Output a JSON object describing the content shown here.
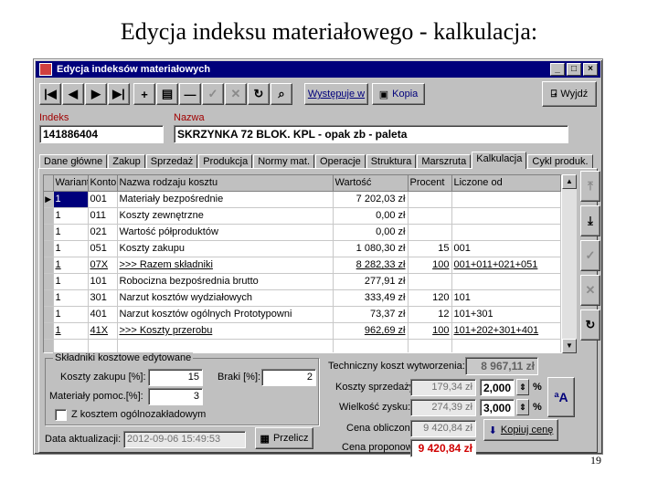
{
  "slide": {
    "title": "Edycja indeksu materiałowego - kalkulacja:",
    "page_number": "19"
  },
  "window": {
    "title": "Edycja indeksów materiałowych",
    "controls": [
      "_",
      "□",
      "×"
    ]
  },
  "toolbar": {
    "buttons": [
      "first-icon",
      "previous-icon",
      "next-icon",
      "last-icon",
      "add-icon",
      "copy-record-icon",
      "delete-icon",
      "confirm-icon",
      "cancel-icon",
      "refresh-icon",
      "find-icon"
    ],
    "wystepuje_label": "Występuje w",
    "kopia_label": "Kopia",
    "wyjdz_label": "Wyjdź"
  },
  "header": {
    "indeks_label": "Indeks",
    "indeks_value": "141886404",
    "nazwa_label": "Nazwa",
    "nazwa_value": "SKRZYNKA 72 BLOK. KPL - opak zb - paleta"
  },
  "tabs": [
    "Dane główne",
    "Zakup",
    "Sprzedaż",
    "Produkcja",
    "Normy mat.",
    "Operacje",
    "Struktura",
    "Marszruta",
    "Kalkulacja",
    "Cykl produk."
  ],
  "active_tab": "Kalkulacja",
  "grid": {
    "columns": [
      "Wariant",
      "Konto",
      "Nazwa rodzaju kosztu",
      "Wartość",
      "Procent",
      "Liczone od"
    ],
    "rows": [
      {
        "marker": "▶",
        "wariant": "1",
        "konto": "001",
        "nazwa": "Materiały bezpośrednie",
        "wartosc": "7 202,03 zł",
        "procent": "",
        "liczone_od": ""
      },
      {
        "marker": "",
        "wariant": "1",
        "konto": "011",
        "nazwa": "Koszty zewnętrzne",
        "wartosc": "0,00 zł",
        "procent": "",
        "liczone_od": ""
      },
      {
        "marker": "",
        "wariant": "1",
        "konto": "021",
        "nazwa": "Wartość półproduktów",
        "wartosc": "0,00 zł",
        "procent": "",
        "liczone_od": ""
      },
      {
        "marker": "",
        "wariant": "1",
        "konto": "051",
        "nazwa": "Koszty zakupu",
        "wartosc": "1 080,30 zł",
        "procent": "15",
        "liczone_od": "001"
      },
      {
        "marker": "",
        "wariant": "1",
        "konto": "07X",
        "nazwa": ">>> Razem składniki",
        "wartosc": "8 282,33 zł",
        "procent": "100",
        "liczone_od": "001+011+021+051"
      },
      {
        "marker": "",
        "wariant": "1",
        "konto": "101",
        "nazwa": "Robocizna bezpośrednia brutto",
        "wartosc": "277,91 zł",
        "procent": "",
        "liczone_od": ""
      },
      {
        "marker": "",
        "wariant": "1",
        "konto": "301",
        "nazwa": "Narzut kosztów wydziałowych",
        "wartosc": "333,49 zł",
        "procent": "120",
        "liczone_od": "101"
      },
      {
        "marker": "",
        "wariant": "1",
        "konto": "401",
        "nazwa": "Narzut kosztów ogólnych Prototypowni",
        "wartosc": "73,37 zł",
        "procent": "12",
        "liczone_od": "101+301"
      },
      {
        "marker": "",
        "wariant": "1",
        "konto": "41X",
        "nazwa": ">>> Koszty przerobu",
        "wartosc": "962,69 zł",
        "procent": "100",
        "liczone_od": "101+202+301+401"
      },
      {
        "marker": "",
        "wariant": "",
        "konto": "",
        "nazwa": "",
        "wartosc": "",
        "procent": "",
        "liczone_od": ""
      }
    ]
  },
  "editable_components": {
    "group_title": "Składniki kosztowe edytowane",
    "koszty_zakupu_label": "Koszty zakupu [%]:",
    "koszty_zakupu_value": "15",
    "braki_label": "Braki [%]:",
    "braki_value": "2",
    "materialy_pomoc_label": "Materiały pomoc.[%]:",
    "materialy_pomoc_value": "3",
    "overhead_checkbox_label": "Z kosztem ogólnozakładowym",
    "overhead_checked": false
  },
  "footer": {
    "data_aktualizacji_label": "Data aktualizacji:",
    "data_aktualizacji_value": "2012-09-06 15:49:53",
    "przelicz_label": "Przelicz"
  },
  "calculation": {
    "techniczny_koszt_label": "Techniczny koszt wytworzenia:",
    "techniczny_koszt_value": "8 967,11 zł",
    "koszty_sprzedazy_label": "Koszty sprzedaży:",
    "koszty_sprzedazy_value": "179,34 zł",
    "koszty_sprzedazy_pct": "2,000",
    "wielkosc_zysku_label": "Wielkość zysku:",
    "wielkosc_zysku_value": "274,39 zł",
    "wielkosc_zysku_pct": "3,000",
    "percent_sign": "%",
    "cena_obliczona_label": "Cena obliczona:",
    "cena_obliczona_value": "9 420,84 zł",
    "cena_proponowana_label": "Cena proponow.",
    "cena_proponowana_value": "9 420,84 zł",
    "kopiuj_cene_label": "Kopiuj cenę"
  },
  "colors": {
    "titlebar": "#00007b",
    "window": "#c0c0c0",
    "label_red": "#a00000",
    "price_red": "#d00000"
  }
}
